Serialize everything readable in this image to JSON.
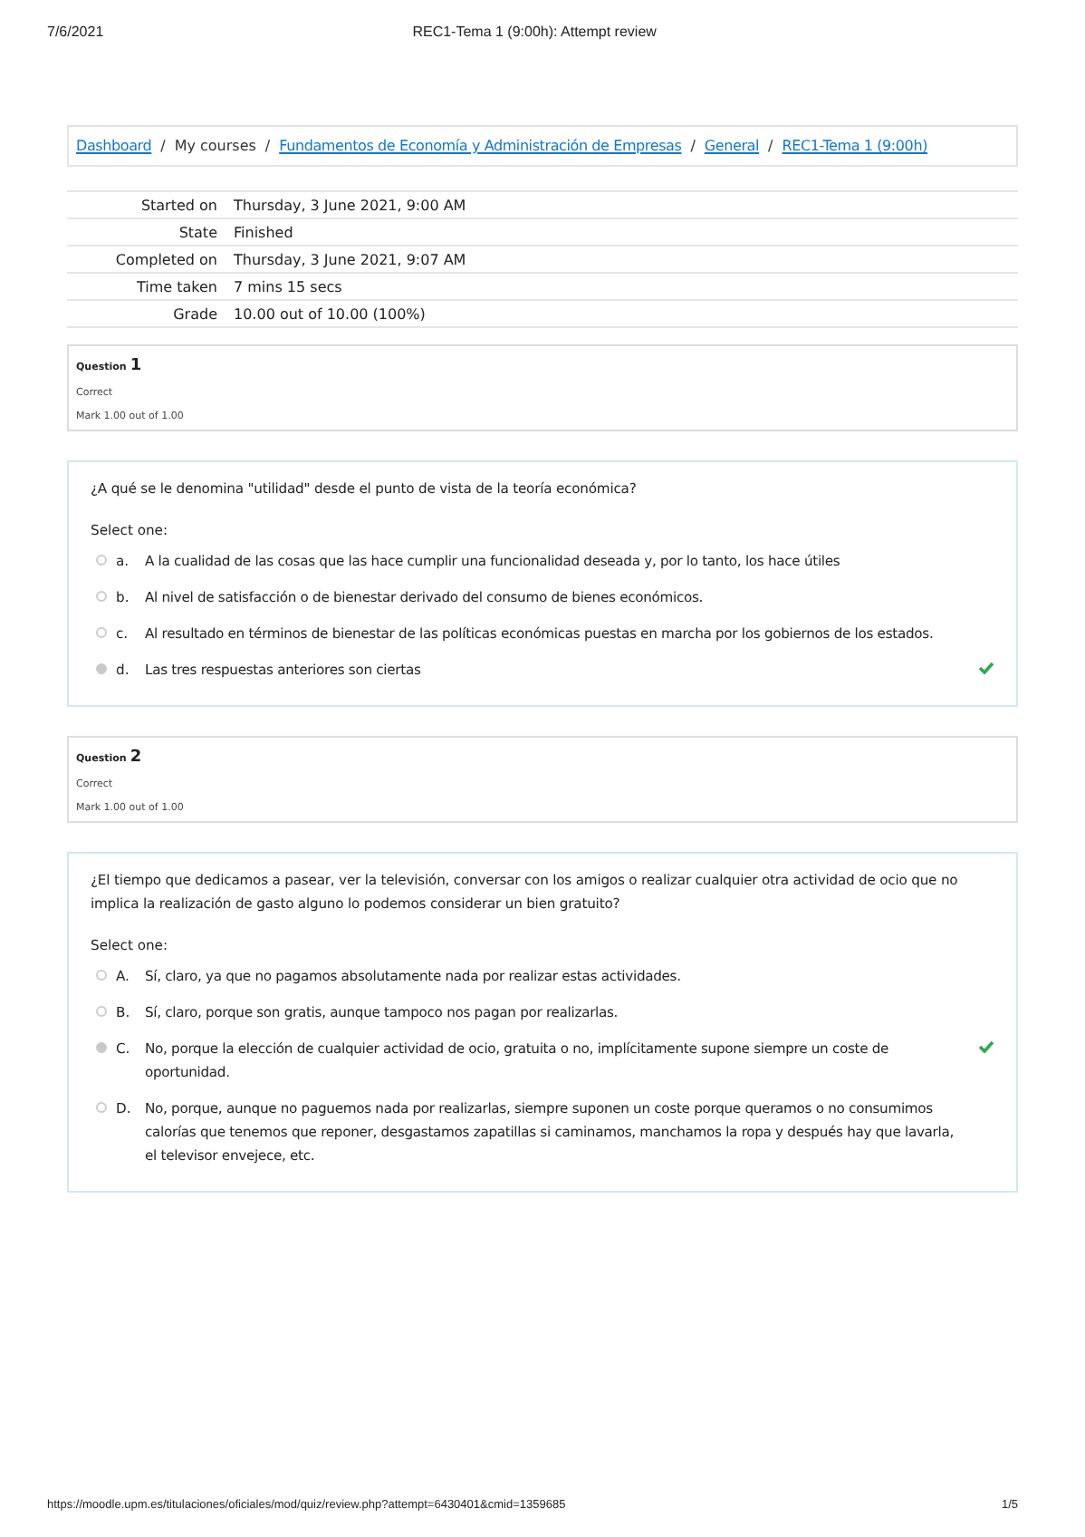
{
  "print_header": {
    "date": "7/6/2021",
    "title": "REC1-Tema 1 (9:00h): Attempt review"
  },
  "breadcrumb": [
    {
      "label": "Dashboard",
      "kind": "link"
    },
    {
      "label": "/",
      "kind": "separator"
    },
    {
      "label": "My courses",
      "kind": "text"
    },
    {
      "label": "/",
      "kind": "separator"
    },
    {
      "label": "Fundamentos de Economía y Administración de Empresas",
      "kind": "link"
    },
    {
      "label": "/",
      "kind": "separator"
    },
    {
      "label": "General",
      "kind": "link"
    },
    {
      "label": "/",
      "kind": "separator"
    },
    {
      "label": "REC1-Tema 1 (9:00h)",
      "kind": "link"
    }
  ],
  "summary": [
    {
      "label": "Started on",
      "value": "Thursday, 3 June 2021, 9:00 AM"
    },
    {
      "label": "State",
      "value": "Finished"
    },
    {
      "label": "Completed on",
      "value": "Thursday, 3 June 2021, 9:07 AM"
    },
    {
      "label": "Time taken",
      "value": "7 mins 15 secs"
    },
    {
      "label": "Grade",
      "value": "10.00 out of 10.00 (100%)"
    }
  ],
  "questions": [
    {
      "heading": "Question",
      "number": "1",
      "status": "Correct",
      "mark": "Mark 1.00 out of 1.00",
      "text": "¿A qué se le denomina \"utilidad\" desde el punto de vista de la teoría económica?",
      "prompt": "Select one:",
      "options": [
        {
          "letter": "a.",
          "text": "A la cualidad de las cosas que las hace cumplir una funcionalidad deseada y, por lo tanto, los hace útiles",
          "selected": false,
          "correct": false
        },
        {
          "letter": "b.",
          "text": "Al nivel de satisfacción o de bienestar derivado del consumo de bienes económicos.",
          "selected": false,
          "correct": false
        },
        {
          "letter": "c.",
          "text": "Al resultado en términos de bienestar de las políticas económicas puestas en marcha por los gobiernos de los estados.",
          "selected": false,
          "correct": false
        },
        {
          "letter": "d.",
          "text": "Las tres respuestas anteriores son ciertas",
          "selected": true,
          "correct": true
        }
      ]
    },
    {
      "heading": "Question",
      "number": "2",
      "status": "Correct",
      "mark": "Mark 1.00 out of 1.00",
      "text": "¿El tiempo que dedicamos a pasear, ver la televisión, conversar con los amigos o realizar cualquier otra actividad de ocio que no implica la realización de gasto alguno lo podemos considerar un bien gratuito?",
      "prompt": "Select one:",
      "options": [
        {
          "letter": "A.",
          "text": "Sí, claro, ya que no pagamos absolutamente nada por realizar estas actividades.",
          "selected": false,
          "correct": false
        },
        {
          "letter": "B.",
          "text": "Sí, claro, porque son gratis, aunque tampoco nos pagan por realizarlas.",
          "selected": false,
          "correct": false
        },
        {
          "letter": "C.",
          "text": "No, porque la elección de cualquier actividad de ocio, gratuita o no, implícitamente supone siempre un coste de oportunidad.",
          "selected": true,
          "correct": true
        },
        {
          "letter": "D.",
          "text": "No, porque, aunque no paguemos nada por realizarlas, siempre suponen un coste porque queramos o no consumimos calorías que tenemos que reponer, desgastamos zapatillas si caminamos, manchamos la ropa y después hay que lavarla, el televisor envejece, etc.",
          "selected": false,
          "correct": false
        }
      ]
    }
  ],
  "print_footer": {
    "url": "https://moodle.upm.es/titulaciones/oficiales/mod/quiz/review.php?attempt=6430401&cmid=1359685",
    "page": "1/5"
  }
}
